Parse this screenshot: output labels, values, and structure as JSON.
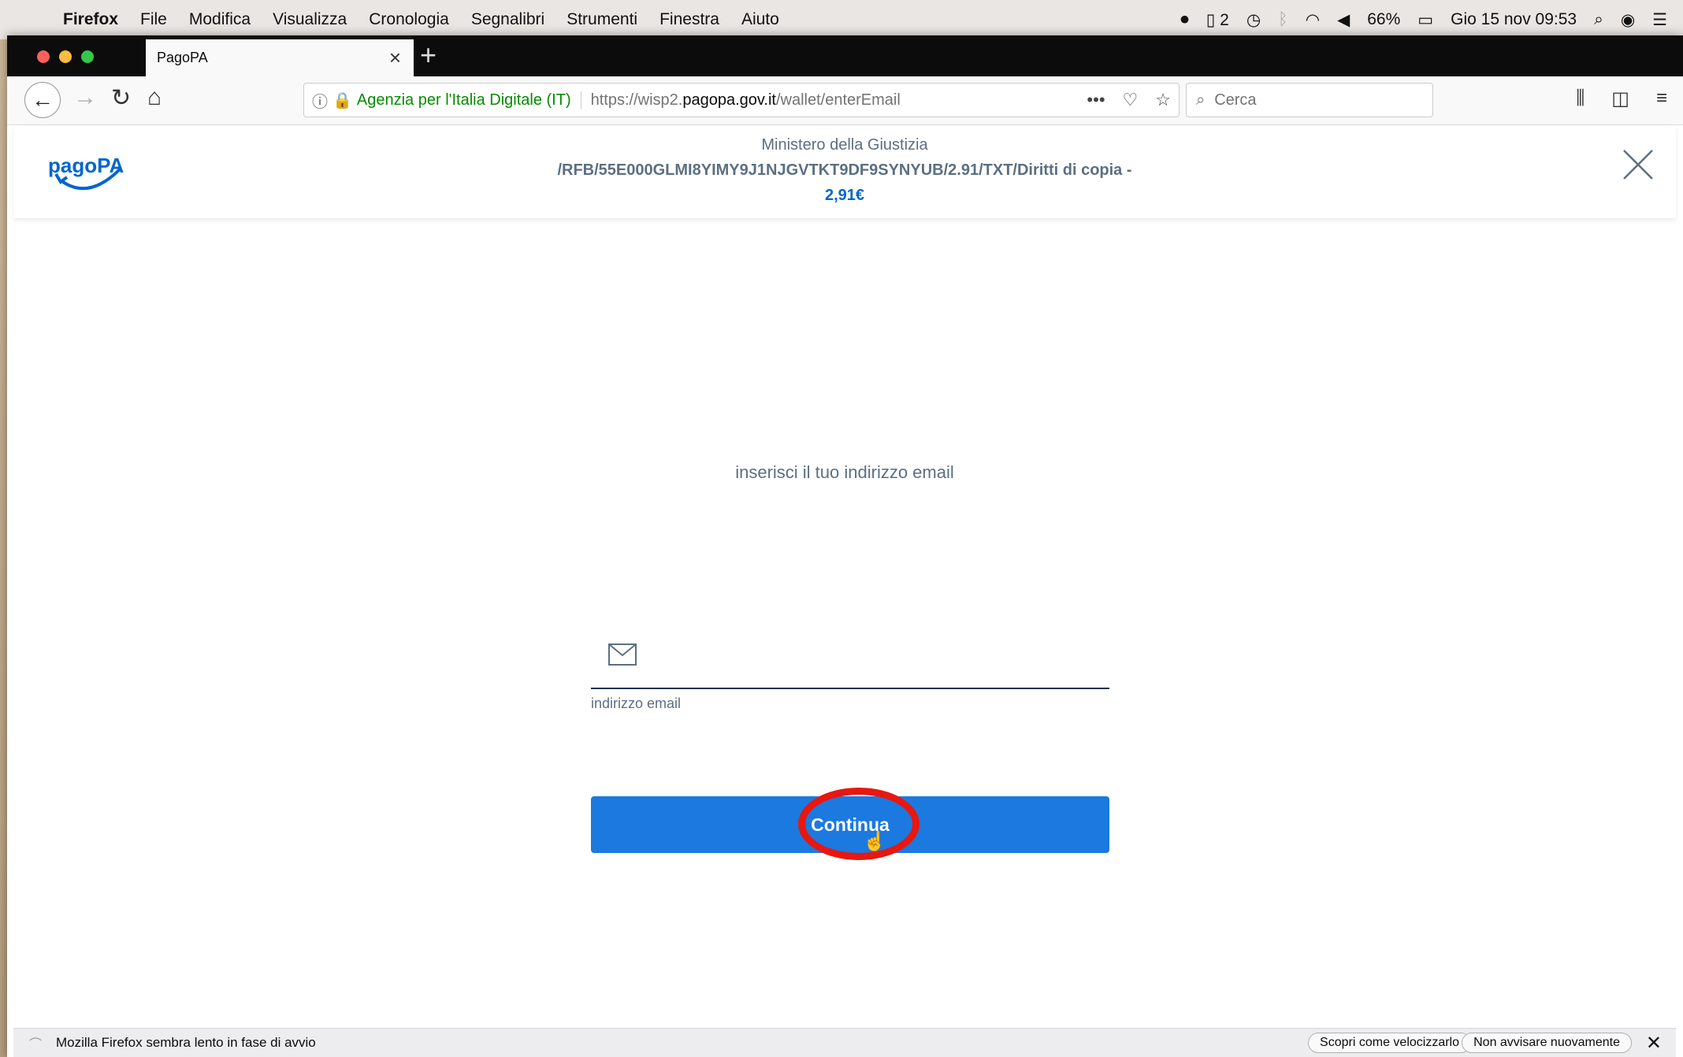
{
  "menubar": {
    "items": [
      "Firefox",
      "File",
      "Modifica",
      "Visualizza",
      "Cronologia",
      "Segnalibri",
      "Strumenti",
      "Finestra",
      "Aiuto"
    ],
    "badge_count": "2",
    "battery": "66%",
    "datetime": "Gio 15 nov  09:53"
  },
  "tab": {
    "title": "PagoPA",
    "close": "×",
    "new": "+"
  },
  "urlbar": {
    "org": "Agenzia per l'Italia Digitale (IT)",
    "url_prefix": "https://wisp2.",
    "url_domain": "pagopa.gov.it",
    "url_path": "/wallet/enterEmail",
    "more": "•••"
  },
  "search": {
    "placeholder": "Cerca"
  },
  "header": {
    "logo_text": "pagoPA",
    "organization": "Ministero della Giustizia",
    "description": "/RFB/55E000GLMI8YIMY9J1NJGVTKT9DF9SYNYUB/2.91/TXT/Diritti di copia -",
    "amount": "2,91€"
  },
  "form": {
    "prompt": "inserisci il tuo indirizzo email",
    "email_value": "",
    "email_label": "indirizzo email",
    "continue_label": "Continua"
  },
  "notification": {
    "message": "Mozilla Firefox sembra lento in fase di avvio",
    "learn_button": "Scopri come velocizzarlo",
    "dismiss_button": "Non avvisare nuovamente"
  },
  "colors": {
    "accent": "#1b79e0",
    "annotation": "#e8170f",
    "text_muted": "#5c6f82"
  }
}
